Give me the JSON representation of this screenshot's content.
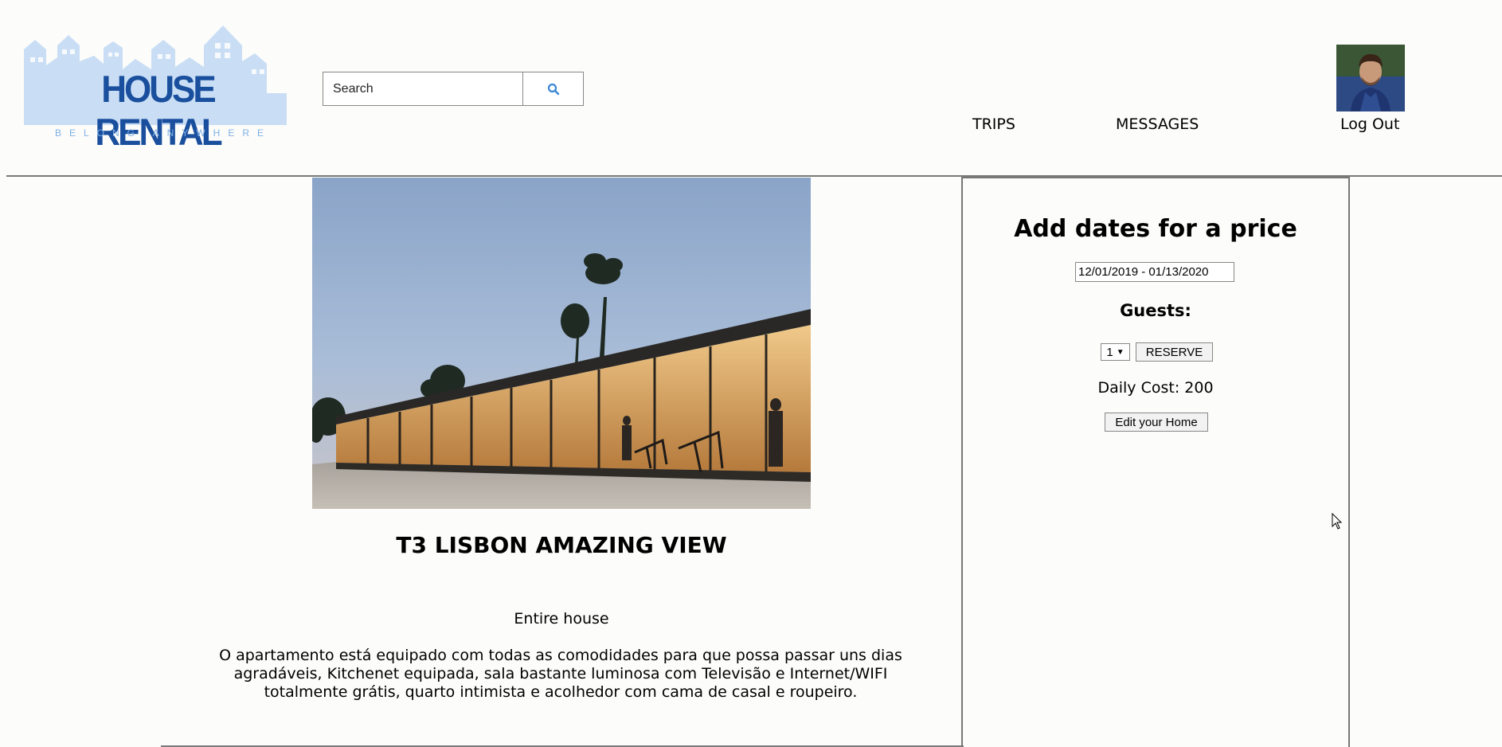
{
  "header": {
    "logo": {
      "title": "HOUSE RENTAL",
      "tagline": "BELONG ANYWHERE"
    },
    "search": {
      "placeholder": "Search",
      "button_icon": "search-icon"
    },
    "nav": {
      "trips": "TRIPS",
      "messages": "MESSAGES",
      "logout": "Log Out"
    },
    "avatar_icon": "user-avatar"
  },
  "listing": {
    "title": "T3 LISBON AMAZING VIEW",
    "type": "Entire house",
    "description": "O apartamento está equipado com todas as comodidades para que possa passar uns dias agradáveis, Kitchenet equipada, sala bastante luminosa com Televisão e Internet/WIFI totalmente grátis, quarto intimista e acolhedor com cama de casal e roupeiro."
  },
  "booking": {
    "heading": "Add dates for a price",
    "date_range": "12/01/2019 - 01/13/2020",
    "guests_label": "Guests:",
    "guests_value": "1",
    "reserve_label": "RESERVE",
    "daily_cost_text": "Daily Cost: 200",
    "edit_label": "Edit your Home"
  },
  "colors": {
    "brand_blue": "#1a4f9e",
    "brand_light": "#c9def5",
    "search_icon": "#3a86d6",
    "rule": "#7a7a7a"
  }
}
